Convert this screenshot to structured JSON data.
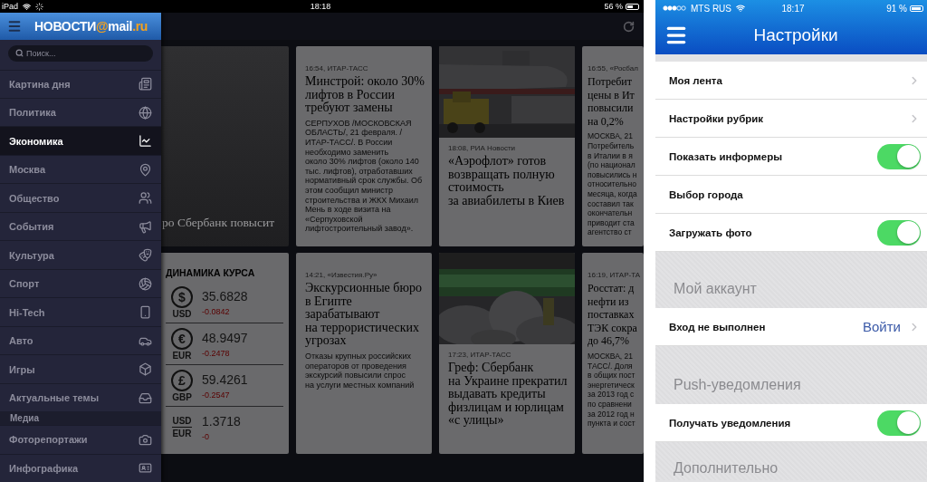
{
  "ipad": {
    "status_bar": {
      "device": "iPad",
      "time": "18:18",
      "battery": "56 %"
    },
    "sidebar": {
      "logo": [
        {
          "text": "НОВОСТИ",
          "accent": false
        },
        {
          "text": "@",
          "accent": true
        },
        {
          "text": "mail",
          "accent": false
        },
        {
          "text": ".ru",
          "accent": true
        }
      ],
      "search": {
        "placeholder": "Поиск..."
      },
      "sections": [
        {
          "items": [
            {
              "label": "Картина дня",
              "selected": false
            },
            {
              "label": "Политика",
              "selected": false
            },
            {
              "label": "Экономика",
              "selected": true
            },
            {
              "label": "Москва",
              "selected": false
            },
            {
              "label": "Общество",
              "selected": false
            },
            {
              "label": "События",
              "selected": false
            },
            {
              "label": "Культура",
              "selected": false
            },
            {
              "label": "Спорт",
              "selected": false
            },
            {
              "label": "Hi-Tech",
              "selected": false
            },
            {
              "label": "Авто",
              "selected": false
            },
            {
              "label": "Игры",
              "selected": false
            },
            {
              "label": "Актуальные темы",
              "selected": false
            }
          ]
        },
        {
          "title": "Медиа",
          "items": [
            {
              "label": "Фоторепортажи",
              "selected": false
            },
            {
              "label": "Инфографика",
              "selected": false
            }
          ]
        }
      ]
    },
    "feed": {
      "rows": [
        [
          {
            "kind": "lead",
            "caption": "ро Сбербанк повысит"
          },
          {
            "kind": "article",
            "meta": "16:54, ИТАР-ТАСС",
            "title_lines": [
              "Минстрой: около 30%",
              "лифтов в России",
              "требуют замены"
            ],
            "body_lines": [
              "СЕРПУХОВ /МОСКОВСКАЯ",
              "ОБЛАСТЬ/, 21 февраля. /",
              "ИТАР-ТАСС/. В России",
              "необходимо заменить",
              "около 30% лифтов (около 140",
              "тыс. лифтов), отработавших",
              "нормативный срок службы. Об",
              "этом сообщил министр",
              "строительства и ЖКХ Михаил",
              "Мень в ходе визита на",
              "«Серпуховской",
              "лифтостроительный завод»."
            ]
          },
          {
            "kind": "article",
            "picture": true,
            "meta": "18:08, РИА Новости",
            "title_lines": [
              "«Аэрофлот» готов",
              "возвращать полную",
              "стоимость",
              "за авиабилеты в Киев"
            ]
          },
          {
            "kind": "article",
            "meta": "16:55, «Росбал",
            "title_lines": [
              "Потребит",
              "цены в Ит",
              "повысили",
              "на 0,2%"
            ],
            "body_lines": [
              "МОСКВА, 21",
              "Потребитель",
              "в Италии в я",
              "(по национал",
              "повысились н",
              "относительно",
              "месяца, когда",
              "составил так",
              "окончательн",
              "приводит ста",
              "агентство ст"
            ]
          }
        ],
        [
          {
            "kind": "currency",
            "title": "ДИНАМИКА КУРСА",
            "rates": [
              {
                "kind": "symbol",
                "symbol": "$",
                "code": "USD",
                "value": "35.6828",
                "change": "-0.0842"
              },
              {
                "kind": "symbol",
                "symbol": "€",
                "code": "EUR",
                "value": "48.9497",
                "change": "-0.2478"
              },
              {
                "kind": "symbol",
                "symbol": "£",
                "code": "GBP",
                "value": "59.4261",
                "change": "-0.2547"
              },
              {
                "kind": "cross",
                "code": "USD",
                "code2": "EUR",
                "value": "1.3718",
                "change": "-0"
              }
            ]
          },
          {
            "kind": "article",
            "meta": "14:21, «Известия.Ру»",
            "title_lines": [
              "Экскурсионные бюро",
              "в Египте",
              "зарабатывают",
              "на террористических",
              "угрозах"
            ],
            "body_lines": [
              "Отказы крупных российских",
              "операторов от проведения",
              "экскурсий повысили спрос",
              "на услуги местных компаний"
            ]
          },
          {
            "kind": "article",
            "picture": true,
            "meta": "17:23, ИТАР-ТАСС",
            "title_lines": [
              "Греф: Сбербанк",
              "на Украине прекратил",
              "выдавать кредиты",
              "физлицам и юрлицам",
              "«с улицы»"
            ]
          },
          {
            "kind": "article",
            "meta": "16:19, ИТАР-ТА",
            "title_lines": [
              "Росстат: д",
              "нефти из",
              "поставках",
              "ТЭК сокра",
              "до 46,7%"
            ],
            "body_lines": [
              "МОСКВА, 21",
              "ТАСС/. Доля",
              "в общих пост",
              "энергетическ",
              "за 2013 год с",
              "по сравнени",
              "за 2012 год н",
              "пункта и сост"
            ]
          }
        ]
      ]
    }
  },
  "iphone": {
    "status_bar": {
      "carrier": "MTS RUS",
      "time": "18:17",
      "battery": "91 %"
    },
    "nav": {
      "title": "Настройки"
    },
    "groups": [
      {
        "rows": [
          {
            "kind": "link",
            "label": "Моя лента"
          },
          {
            "kind": "link",
            "label": "Настройки рубрик"
          },
          {
            "kind": "toggle",
            "label": "Показать информеры",
            "on": true
          },
          {
            "kind": "plain",
            "label": "Выбор города"
          },
          {
            "kind": "toggle",
            "label": "Загружать фото",
            "on": true
          }
        ]
      },
      {
        "header": "Мой аккаунт",
        "rows": [
          {
            "kind": "link",
            "label": "Вход не выполнен",
            "action": "Войти"
          }
        ]
      },
      {
        "header": "Push-уведомления",
        "rows": [
          {
            "kind": "toggle",
            "label": "Получать уведомления",
            "on": true
          }
        ]
      },
      {
        "header": "Дополнительно"
      }
    ]
  }
}
